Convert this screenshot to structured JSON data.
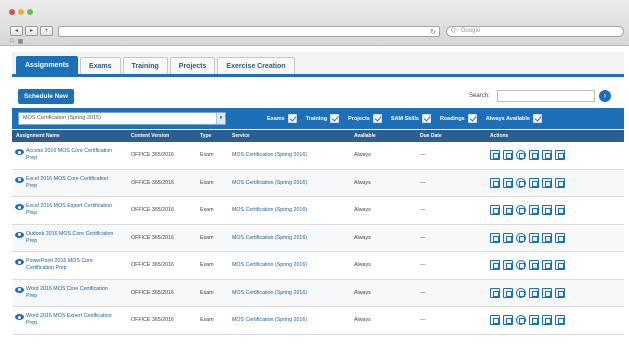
{
  "browser": {
    "nav_back": "◂",
    "nav_forward": "▸",
    "nav_add": "+",
    "reload_icon": "↻",
    "search_placeholder": "Q~ Google",
    "bookmark_icons": [
      "□",
      "▦"
    ]
  },
  "tabs": [
    {
      "label": "Assignments",
      "active": true
    },
    {
      "label": "Exams",
      "active": false
    },
    {
      "label": "Training",
      "active": false
    },
    {
      "label": "Projects",
      "active": false
    },
    {
      "label": "Exercise Creation",
      "active": false
    }
  ],
  "toolbar": {
    "schedule_label": "Schedule New",
    "search_label": "Search:",
    "search_value": "",
    "search_go_icon": "›"
  },
  "filterbar": {
    "selected_option": "MOS Certification (Spring 2015)",
    "dropdown_icon": "▾",
    "filters": [
      "Exams",
      "Training",
      "Projects",
      "SAM Skills",
      "Readings",
      "Always Available"
    ]
  },
  "table": {
    "headers": [
      "Assignment Name",
      "Content Version",
      "Type",
      "Service",
      "Available",
      "Due Date",
      "Actions"
    ],
    "rows": [
      {
        "name": "Access 2016 MOS Core Certification Prep",
        "version": "OFFICE 365/2016",
        "type": "Exam",
        "service": "MOS Certification (Spring 2016)",
        "available": "Always",
        "due": "—"
      },
      {
        "name": "Excel 2016 MOS Core Certification Prep",
        "version": "OFFICE 365/2016",
        "type": "Exam",
        "service": "MOS Certification (Spring 2016)",
        "available": "Always",
        "due": "—"
      },
      {
        "name": "Excel 2016 MOS Expert Certification Prep",
        "version": "OFFICE 365/2016",
        "type": "Exam",
        "service": "MOS Certification (Spring 2016)",
        "available": "Always",
        "due": "—"
      },
      {
        "name": "Outlook 2016 MOS Core Certification Prep",
        "version": "OFFICE 365/2016",
        "type": "Exam",
        "service": "MOS Certification (Spring 2016)",
        "available": "Always",
        "due": "—"
      },
      {
        "name": "PowerPoint 2016 MOS Core Certification Prep",
        "version": "OFFICE 365/2016",
        "type": "Exam",
        "service": "MOS Certification (Spring 2016)",
        "available": "Always",
        "due": "—"
      },
      {
        "name": "Word 2016 MOS Core Certification Prep",
        "version": "OFFICE 365/2016",
        "type": "Exam",
        "service": "MOS Certification (Spring 2016)",
        "available": "Always",
        "due": "—"
      },
      {
        "name": "Word 2016 MOS Expert Certification Prep",
        "version": "OFFICE 365/2016",
        "type": "Exam",
        "service": "MOS Certification (Spring 2016)",
        "available": "Always",
        "due": "—"
      }
    ],
    "action_icons": [
      "edit-icon",
      "copy-icon",
      "preview-icon",
      "person-icon",
      "report-icon",
      "calendar-icon"
    ]
  }
}
